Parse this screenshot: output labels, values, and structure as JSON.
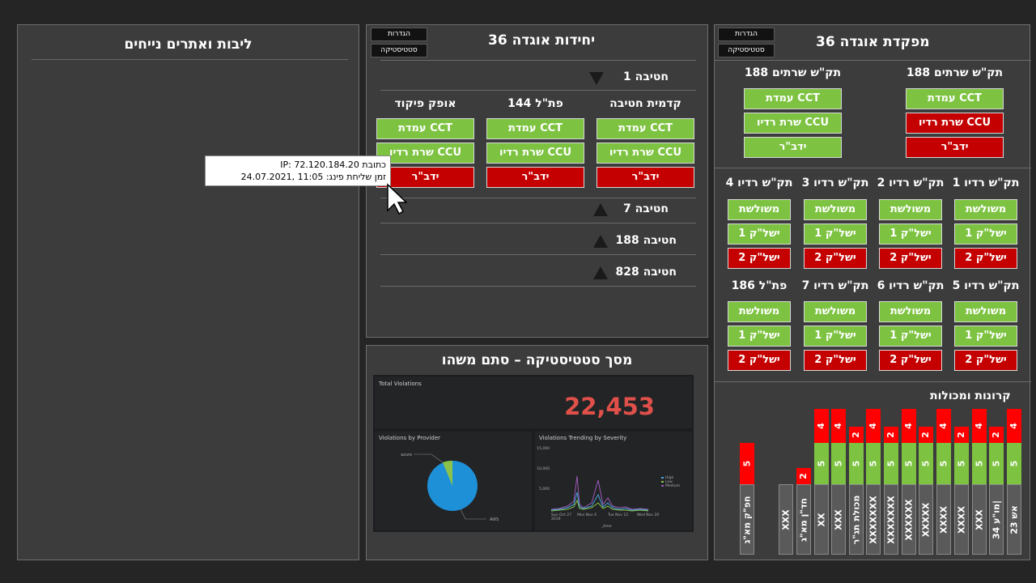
{
  "left_panel": {
    "title": "ליבות ואתרים נייחים"
  },
  "units_panel": {
    "title": "יחידות אוגדה 36",
    "btn_settings": "הגדרות",
    "btn_stats": "סטטיסטיקה",
    "brigade1": "חטיבה 1",
    "columns": [
      {
        "header": "קדמית חטיבה",
        "items": [
          {
            "label": "עמדת CCT",
            "status": "ok"
          },
          {
            "label": "שרת רדיו CCU",
            "status": "ok"
          },
          {
            "label": "ידב\"ר",
            "status": "err"
          }
        ]
      },
      {
        "header": "פת\"ל 144",
        "items": [
          {
            "label": "עמדת CCT",
            "status": "ok"
          },
          {
            "label": "שרת רדיו CCU",
            "status": "ok"
          },
          {
            "label": "ידב\"ר",
            "status": "err"
          }
        ]
      },
      {
        "header": "אופק פיקוד",
        "items": [
          {
            "label": "עמדת CCT",
            "status": "ok"
          },
          {
            "label": "שרת רדיו CCU",
            "status": "ok"
          },
          {
            "label": "ידב\"ר",
            "status": "err"
          }
        ]
      }
    ],
    "brigades": [
      "חטיבה 7",
      "חטיבה 188",
      "חטיבה 828"
    ],
    "tooltip": {
      "line1": "כתובת IP: 72.120.184.20",
      "line2": "זמן שליחת פינג: 11:05 ,24.07.2021"
    }
  },
  "stats_panel": {
    "title": "מסך סטטיסטיקה – סתם משהו",
    "total_label": "Total Violations",
    "total_value": "22,453",
    "provider_title": "Violations by Provider",
    "trend_title": "Violations Trending by Severity",
    "pie_labels": [
      "azure",
      "AWS"
    ],
    "y_ticks": [
      "15,000",
      "10,000",
      "5,000"
    ],
    "x_ticks": [
      "Sun Oct 27\n2019",
      "Mon Nov 4",
      "Tue Nov 12",
      "Wed Nov 20"
    ],
    "x_label": "_time",
    "legend": [
      "High",
      "Low",
      "Medium"
    ],
    "colors": {
      "value": "#e0504a",
      "pie_main": "#1e90d8",
      "pie_slice": "#8bc34a",
      "high": "#4aa3df",
      "low": "#8bc34a",
      "medium": "#9b59b6"
    }
  },
  "hq_panel": {
    "title": "מפקדת אוגדה 36",
    "btn_settings": "הגדרות",
    "btn_stats": "סטטיסטיקה",
    "servers": [
      {
        "header": "תק\"ש שרתים 188",
        "items": [
          {
            "label": "עמדת CCT",
            "status": "ok"
          },
          {
            "label": "שרת רדיו CCU",
            "status": "err"
          },
          {
            "label": "ידב\"ר",
            "status": "err"
          }
        ]
      },
      {
        "header": "תק\"ש שרתים 188",
        "items": [
          {
            "label": "עמדת CCT",
            "status": "ok"
          },
          {
            "label": "שרת רדיו CCU",
            "status": "ok"
          },
          {
            "label": "ידב\"ר",
            "status": "ok"
          }
        ]
      }
    ],
    "radios_row1": [
      {
        "header": "תק\"ש רדיו 1",
        "items": [
          {
            "label": "משולשת",
            "status": "ok"
          },
          {
            "label": "ישל\"ק 1",
            "status": "ok"
          },
          {
            "label": "ישל\"ק 2",
            "status": "err"
          }
        ]
      },
      {
        "header": "תק\"ש רדיו 2",
        "items": [
          {
            "label": "משולשת",
            "status": "ok"
          },
          {
            "label": "ישל\"ק 1",
            "status": "ok"
          },
          {
            "label": "ישל\"ק 2",
            "status": "err"
          }
        ]
      },
      {
        "header": "תק\"ש רדיו 3",
        "items": [
          {
            "label": "משולשת",
            "status": "ok"
          },
          {
            "label": "ישל\"ק 1",
            "status": "ok"
          },
          {
            "label": "ישל\"ק 2",
            "status": "err"
          }
        ]
      },
      {
        "header": "תק\"ש רדיו 4",
        "items": [
          {
            "label": "משולשת",
            "status": "ok"
          },
          {
            "label": "ישל\"ק 1",
            "status": "ok"
          },
          {
            "label": "ישל\"ק 2",
            "status": "err"
          }
        ]
      }
    ],
    "radios_row2": [
      {
        "header": "תק\"ש רדיו 5",
        "items": [
          {
            "label": "משולשת",
            "status": "ok"
          },
          {
            "label": "ישל\"ק 1",
            "status": "ok"
          },
          {
            "label": "ישל\"ק 2",
            "status": "err"
          }
        ]
      },
      {
        "header": "תק\"ש רדיו 6",
        "items": [
          {
            "label": "משולשת",
            "status": "ok"
          },
          {
            "label": "ישל\"ק 1",
            "status": "ok"
          },
          {
            "label": "ישל\"ק 2",
            "status": "err"
          }
        ]
      },
      {
        "header": "תק\"ש רדיו 7",
        "items": [
          {
            "label": "משולשת",
            "status": "ok"
          },
          {
            "label": "ישל\"ק 1",
            "status": "ok"
          },
          {
            "label": "ישל\"ק 2",
            "status": "err"
          }
        ]
      },
      {
        "header": "פת\"ל 186",
        "items": [
          {
            "label": "משולשת",
            "status": "ok"
          },
          {
            "label": "ישל\"ק 1",
            "status": "ok"
          },
          {
            "label": "ישל\"ק 2",
            "status": "err"
          }
        ]
      }
    ],
    "wagons": {
      "title": "קרונות ומכולות",
      "columns": [
        {
          "label": "אש 23",
          "green": 5,
          "red": 4
        },
        {
          "label": "מו\"ע 34|",
          "green": 5,
          "red": 2
        },
        {
          "label": "XXX",
          "green": 5,
          "red": 4
        },
        {
          "label": "XXXX",
          "green": 5,
          "red": 2
        },
        {
          "label": "XXXX",
          "green": 5,
          "red": 4
        },
        {
          "label": "XXXXX",
          "green": 5,
          "red": 2
        },
        {
          "label": "XXXXXX",
          "green": 5,
          "red": 4
        },
        {
          "label": "XXXXXXX",
          "green": 5,
          "red": 2
        },
        {
          "label": "XXXXXXX",
          "green": 5,
          "red": 4
        },
        {
          "label": "מכולת תג\"ר",
          "green": 5,
          "red": 2
        },
        {
          "label": "XXX",
          "green": 5,
          "red": 4
        },
        {
          "label": "XX",
          "green": 5,
          "red": 4
        },
        {
          "label": "חד\"ן מא\"ג",
          "green": null,
          "red": 2
        },
        {
          "label": "XXX",
          "green": null,
          "red": null
        },
        {
          "label": "חפ\"ק מא\"ג",
          "green": null,
          "red": 5
        }
      ]
    }
  }
}
